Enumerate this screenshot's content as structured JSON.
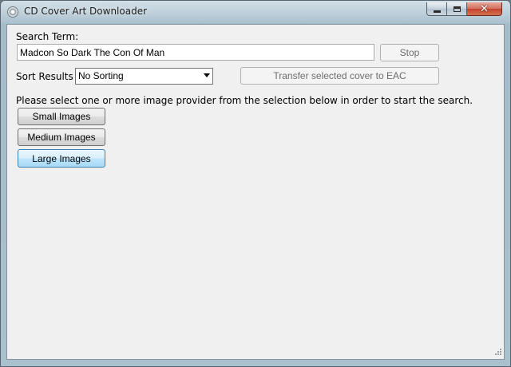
{
  "window": {
    "title": "CD Cover Art Downloader",
    "icon": "cd-disc-icon"
  },
  "search": {
    "label": "Search Term:",
    "value": "Madcon So Dark The Con Of Man",
    "stop_label": "Stop"
  },
  "sort": {
    "label": "Sort Results :",
    "selected": "No Sorting"
  },
  "transfer": {
    "label": "Transfer selected cover to EAC"
  },
  "instructions": "Please select one or more image provider from the selection below in order to start the search.",
  "providers": [
    {
      "label": "Small Images",
      "selected": false
    },
    {
      "label": "Medium Images",
      "selected": false
    },
    {
      "label": "Large Images",
      "selected": true
    }
  ]
}
